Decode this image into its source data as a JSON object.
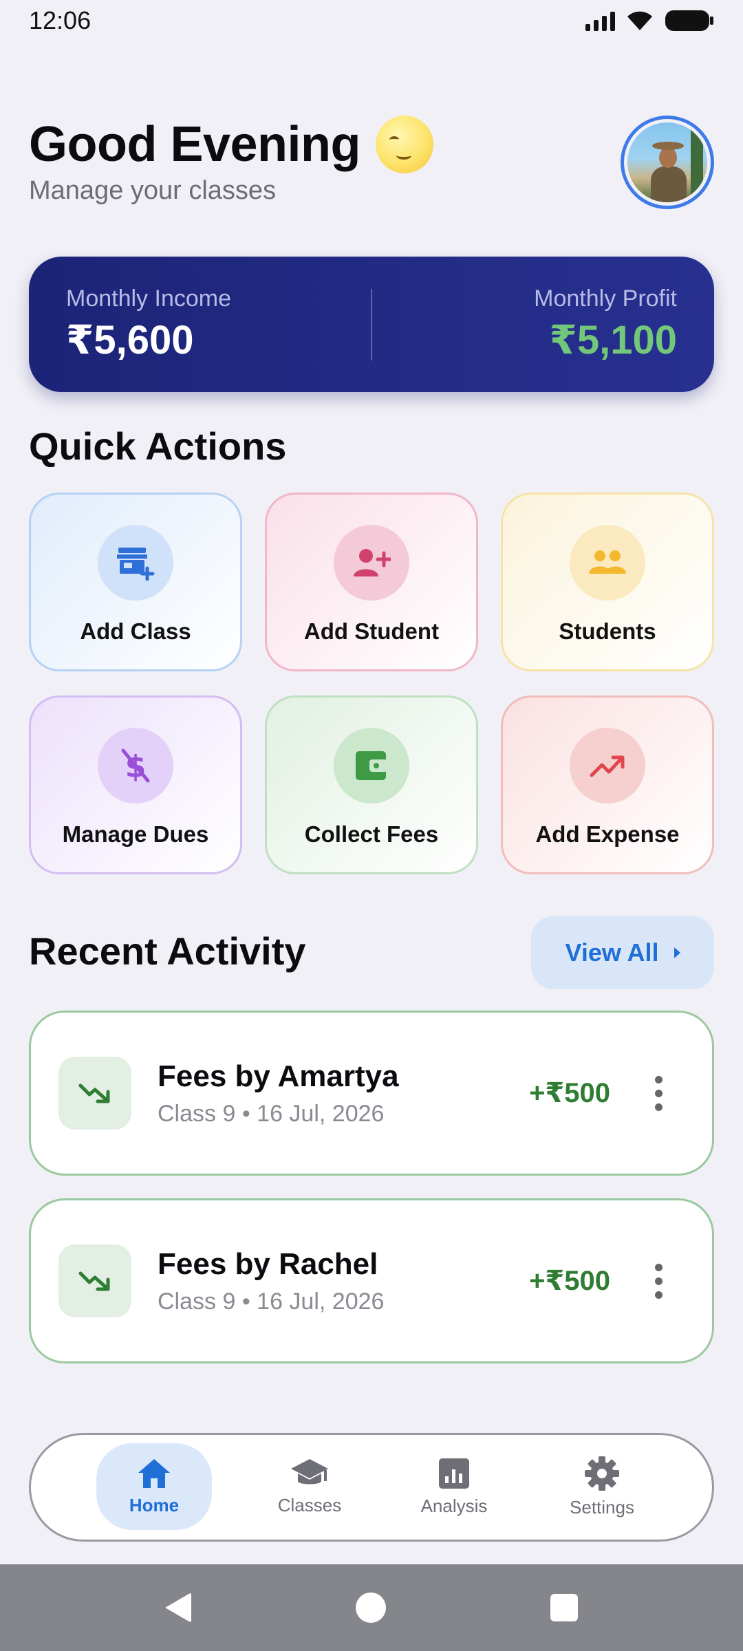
{
  "status_bar": {
    "time": "12:06"
  },
  "header": {
    "greeting": "Good Evening",
    "subtitle": "Manage your classes"
  },
  "summary": {
    "income_label": "Monthly Income",
    "income_value": "₹5,600",
    "profit_label": "Monthly Profit",
    "profit_value": "₹5,100"
  },
  "quick_actions": {
    "title": "Quick Actions",
    "items": [
      {
        "label": "Add Class",
        "icon": "store-add-icon",
        "color": "#2f6fd8"
      },
      {
        "label": "Add Student",
        "icon": "person-add-icon",
        "color": "#d0416e"
      },
      {
        "label": "Students",
        "icon": "group-icon",
        "color": "#f3b82c"
      },
      {
        "label": "Manage Dues",
        "icon": "money-off-icon",
        "color": "#9a4fd9"
      },
      {
        "label": "Collect Fees",
        "icon": "wallet-icon",
        "color": "#3e9a44"
      },
      {
        "label": "Add Expense",
        "icon": "trending-up-icon",
        "color": "#e0474c"
      }
    ]
  },
  "recent_activity": {
    "title": "Recent Activity",
    "view_all_label": "View All",
    "items": [
      {
        "title": "Fees by Amartya",
        "meta": "Class 9 • 16 Jul, 2026",
        "amount": "+₹500",
        "icon": "trending-down-icon"
      },
      {
        "title": "Fees by Rachel",
        "meta": "Class 9 • 16 Jul, 2026",
        "amount": "+₹500",
        "icon": "trending-down-icon"
      }
    ]
  },
  "bottom_nav": {
    "items": [
      {
        "label": "Home",
        "icon": "home-icon",
        "active": true
      },
      {
        "label": "Classes",
        "icon": "school-icon",
        "active": false
      },
      {
        "label": "Analysis",
        "icon": "analytics-icon",
        "active": false
      },
      {
        "label": "Settings",
        "icon": "settings-icon",
        "active": false
      }
    ]
  },
  "colors": {
    "accent": "#1f6fd6",
    "summary_bg": "#1c2478",
    "profit": "#72c77a",
    "amount_positive": "#2f7d32"
  }
}
